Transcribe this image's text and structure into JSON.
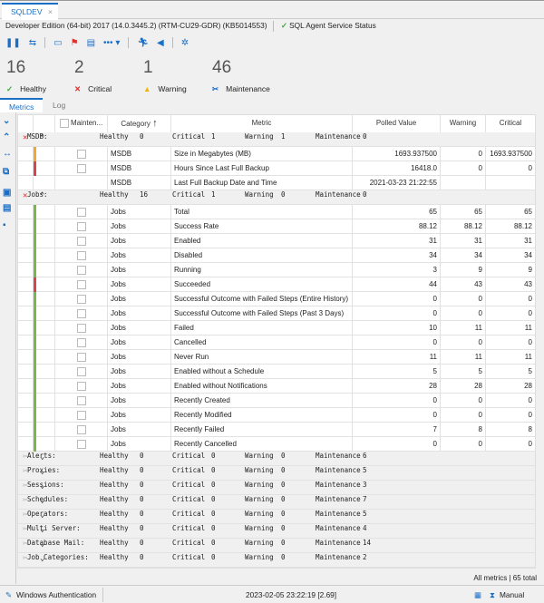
{
  "tab": {
    "title": "SQLDEV",
    "close": "×"
  },
  "info": {
    "edition": "Developer Edition (64-bit) 2017 (14.0.3445.2) (RTM-CU29-GDR) (KB5014553)",
    "agent_status": "SQL Agent Service Status"
  },
  "toolbar": [
    "pause-icon",
    "refresh-icon",
    "monitor-icon",
    "flag-icon",
    "document-icon",
    "more-icon",
    "run-icon",
    "announce-icon",
    "settings-icon"
  ],
  "stats": [
    {
      "value": "16",
      "label": "Healthy",
      "color": "#3aa53a"
    },
    {
      "value": "2",
      "label": "Critical",
      "color": "#e0312b"
    },
    {
      "value": "1",
      "label": "Warning",
      "color": "#f0b400"
    },
    {
      "value": "46",
      "label": "Maintenance",
      "color": "#1b6fc6"
    }
  ],
  "subtabs": {
    "metrics": "Metrics",
    "log": "Log"
  },
  "columns": {
    "maintenance": "Mainten...",
    "category": "Category",
    "sort": "↑",
    "metric": "Metric",
    "polled": "Polled Value",
    "warning": "Warning",
    "critical": "Critical"
  },
  "colors": {
    "green": "#7ab648",
    "red": "#d9434e",
    "orange": "#f0a830"
  },
  "groups": [
    {
      "name": "MSDB:",
      "healthy": "0",
      "critical": "1",
      "warning": "1",
      "maintenance": "0",
      "status": "critical",
      "expanded": true,
      "rows": [
        {
          "status": "orange",
          "category": "MSDB",
          "metric": "Size in Megabytes (MB)",
          "polled": "1693.937500",
          "warning": "0",
          "critical": "1693.937500",
          "checkbox": true
        },
        {
          "status": "red",
          "category": "MSDB",
          "metric": "Hours Since Last Full Backup",
          "polled": "16418.0",
          "warning": "0",
          "critical": "0",
          "checkbox": true
        },
        {
          "status": "",
          "category": "MSDB",
          "metric": "Last Full Backup Date and Time",
          "polled": "2021-03-23 21:22:55",
          "warning": "",
          "critical": "",
          "checkbox": false
        }
      ]
    },
    {
      "name": "Jobs:",
      "healthy": "16",
      "critical": "1",
      "warning": "0",
      "maintenance": "0",
      "status": "critical",
      "expanded": true,
      "rows": [
        {
          "status": "green",
          "category": "Jobs",
          "metric": "Total",
          "polled": "65",
          "warning": "65",
          "critical": "65",
          "checkbox": true
        },
        {
          "status": "green",
          "category": "Jobs",
          "metric": "Success Rate",
          "polled": "88.12",
          "warning": "88.12",
          "critical": "88.12",
          "checkbox": true
        },
        {
          "status": "green",
          "category": "Jobs",
          "metric": "Enabled",
          "polled": "31",
          "warning": "31",
          "critical": "31",
          "checkbox": true
        },
        {
          "status": "green",
          "category": "Jobs",
          "metric": "Disabled",
          "polled": "34",
          "warning": "34",
          "critical": "34",
          "checkbox": true
        },
        {
          "status": "green",
          "category": "Jobs",
          "metric": "Running",
          "polled": "3",
          "warning": "9",
          "critical": "9",
          "checkbox": true
        },
        {
          "status": "red",
          "category": "Jobs",
          "metric": "Succeeded",
          "polled": "44",
          "warning": "43",
          "critical": "43",
          "checkbox": true
        },
        {
          "status": "green",
          "category": "Jobs",
          "metric": "Successful Outcome with Failed Steps (Entire History)",
          "polled": "0",
          "warning": "0",
          "critical": "0",
          "checkbox": true
        },
        {
          "status": "green",
          "category": "Jobs",
          "metric": "Successful Outcome with Failed Steps (Past 3 Days)",
          "polled": "0",
          "warning": "0",
          "critical": "0",
          "checkbox": true
        },
        {
          "status": "green",
          "category": "Jobs",
          "metric": "Failed",
          "polled": "10",
          "warning": "11",
          "critical": "11",
          "checkbox": true
        },
        {
          "status": "green",
          "category": "Jobs",
          "metric": "Cancelled",
          "polled": "0",
          "warning": "0",
          "critical": "0",
          "checkbox": true
        },
        {
          "status": "green",
          "category": "Jobs",
          "metric": "Never Run",
          "polled": "11",
          "warning": "11",
          "critical": "11",
          "checkbox": true
        },
        {
          "status": "green",
          "category": "Jobs",
          "metric": "Enabled without a Schedule",
          "polled": "5",
          "warning": "5",
          "critical": "5",
          "checkbox": true
        },
        {
          "status": "green",
          "category": "Jobs",
          "metric": "Enabled without Notifications",
          "polled": "28",
          "warning": "28",
          "critical": "28",
          "checkbox": true
        },
        {
          "status": "green",
          "category": "Jobs",
          "metric": "Recently Created",
          "polled": "0",
          "warning": "0",
          "critical": "0",
          "checkbox": true
        },
        {
          "status": "green",
          "category": "Jobs",
          "metric": "Recently Modified",
          "polled": "0",
          "warning": "0",
          "critical": "0",
          "checkbox": true
        },
        {
          "status": "green",
          "category": "Jobs",
          "metric": "Recently Failed",
          "polled": "7",
          "warning": "8",
          "critical": "8",
          "checkbox": true
        },
        {
          "status": "green",
          "category": "Jobs",
          "metric": "Recently Cancelled",
          "polled": "0",
          "warning": "0",
          "critical": "0",
          "checkbox": true
        }
      ]
    },
    {
      "name": "Alerts:",
      "healthy": "0",
      "critical": "0",
      "warning": "0",
      "maintenance": "6",
      "status": "maintenance",
      "expanded": false,
      "rows": []
    },
    {
      "name": "Proxies:",
      "healthy": "0",
      "critical": "0",
      "warning": "0",
      "maintenance": "5",
      "status": "maintenance",
      "expanded": false,
      "rows": []
    },
    {
      "name": "Sessions:",
      "healthy": "0",
      "critical": "0",
      "warning": "0",
      "maintenance": "3",
      "status": "maintenance",
      "expanded": false,
      "rows": []
    },
    {
      "name": "Schedules:",
      "healthy": "0",
      "critical": "0",
      "warning": "0",
      "maintenance": "7",
      "status": "maintenance",
      "expanded": false,
      "rows": []
    },
    {
      "name": "Operators:",
      "healthy": "0",
      "critical": "0",
      "warning": "0",
      "maintenance": "5",
      "status": "maintenance",
      "expanded": false,
      "rows": []
    },
    {
      "name": "Multi Server:",
      "healthy": "0",
      "critical": "0",
      "warning": "0",
      "maintenance": "4",
      "status": "maintenance",
      "expanded": false,
      "rows": []
    },
    {
      "name": "Database Mail:",
      "healthy": "0",
      "critical": "0",
      "warning": "0",
      "maintenance": "14",
      "status": "maintenance",
      "expanded": false,
      "rows": []
    },
    {
      "name": "Job Categories:",
      "healthy": "0",
      "critical": "0",
      "warning": "0",
      "maintenance": "2",
      "status": "maintenance",
      "expanded": false,
      "rows": []
    }
  ],
  "group_labels": {
    "healthy": "Healthy",
    "critical": "Critical",
    "warning": "Warning",
    "maintenance": "Maintenance"
  },
  "summary": "All metrics | 65 total",
  "statusbar": {
    "auth": "Windows Authentication",
    "timestamp": "2023-02-05 23:22:19 [2.69]",
    "mode": "Manual"
  }
}
